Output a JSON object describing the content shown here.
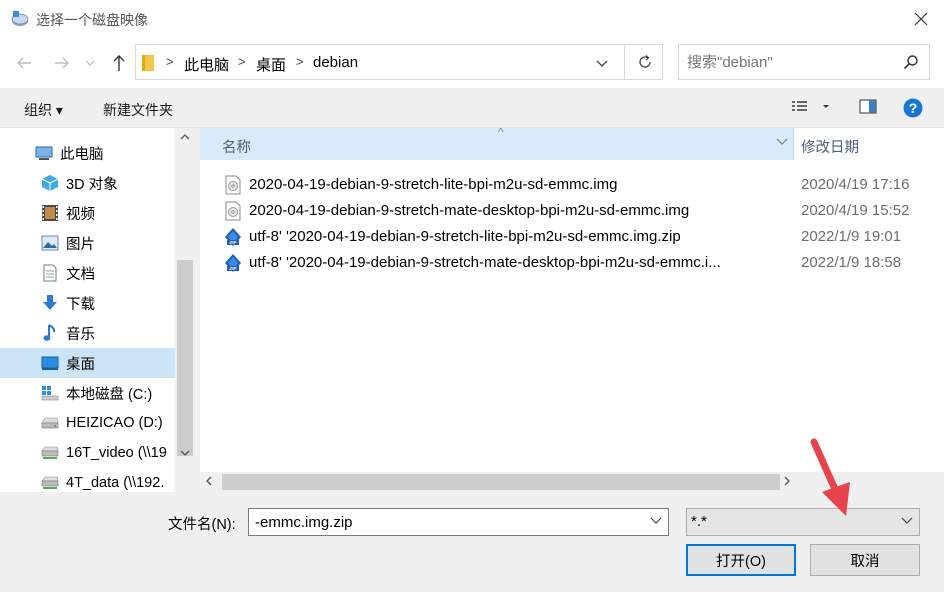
{
  "window": {
    "title": "选择一个磁盘映像",
    "close_icon": "close-icon"
  },
  "nav": {
    "breadcrumbs": [
      "此电脑",
      "桌面",
      "debian"
    ],
    "search_placeholder": "搜索\"debian\""
  },
  "toolbar": {
    "organize": "组织 ▾",
    "new_folder": "新建文件夹"
  },
  "sidebar": {
    "items": [
      {
        "label": "此电脑",
        "icon": "computer-icon"
      },
      {
        "label": "3D 对象",
        "icon": "3d-objects-icon"
      },
      {
        "label": "视频",
        "icon": "video-icon"
      },
      {
        "label": "图片",
        "icon": "pictures-icon"
      },
      {
        "label": "文档",
        "icon": "documents-icon"
      },
      {
        "label": "下载",
        "icon": "download-icon"
      },
      {
        "label": "音乐",
        "icon": "music-icon"
      },
      {
        "label": "桌面",
        "icon": "desktop-icon",
        "selected": true
      },
      {
        "label": "本地磁盘 (C:)",
        "icon": "local-disk-icon"
      },
      {
        "label": "HEIZICAO (D:)",
        "icon": "drive-icon"
      },
      {
        "label": "16T_video (\\\\19",
        "icon": "network-drive-icon"
      },
      {
        "label": "4T_data (\\\\192.",
        "icon": "network-drive-icon"
      }
    ]
  },
  "columns": {
    "name": "名称",
    "date": "修改日期"
  },
  "files": [
    {
      "name": "2020-04-19-debian-9-stretch-lite-bpi-m2u-sd-emmc.img",
      "date": "2020/4/19 17:16",
      "icon": "disk-image-icon"
    },
    {
      "name": "2020-04-19-debian-9-stretch-mate-desktop-bpi-m2u-sd-emmc.img",
      "date": "2020/4/19 15:52",
      "icon": "disk-image-icon"
    },
    {
      "name": "utf-8' '2020-04-19-debian-9-stretch-lite-bpi-m2u-sd-emmc.img.zip",
      "date": "2022/1/9 19:01",
      "icon": "zip-archive-icon"
    },
    {
      "name": "utf-8' '2020-04-19-debian-9-stretch-mate-desktop-bpi-m2u-sd-emmc.i...",
      "date": "2022/1/9 18:58",
      "icon": "zip-archive-icon"
    }
  ],
  "footer": {
    "filename_label": "文件名(N):",
    "filename_value": "-emmc.img.zip",
    "filter_value": "*.*",
    "open_button": "打开(O)",
    "cancel_button": "取消"
  },
  "colors": {
    "accent": "#0078d7",
    "selection": "#cce4f7",
    "annotation_arrow": "#e8424a"
  }
}
